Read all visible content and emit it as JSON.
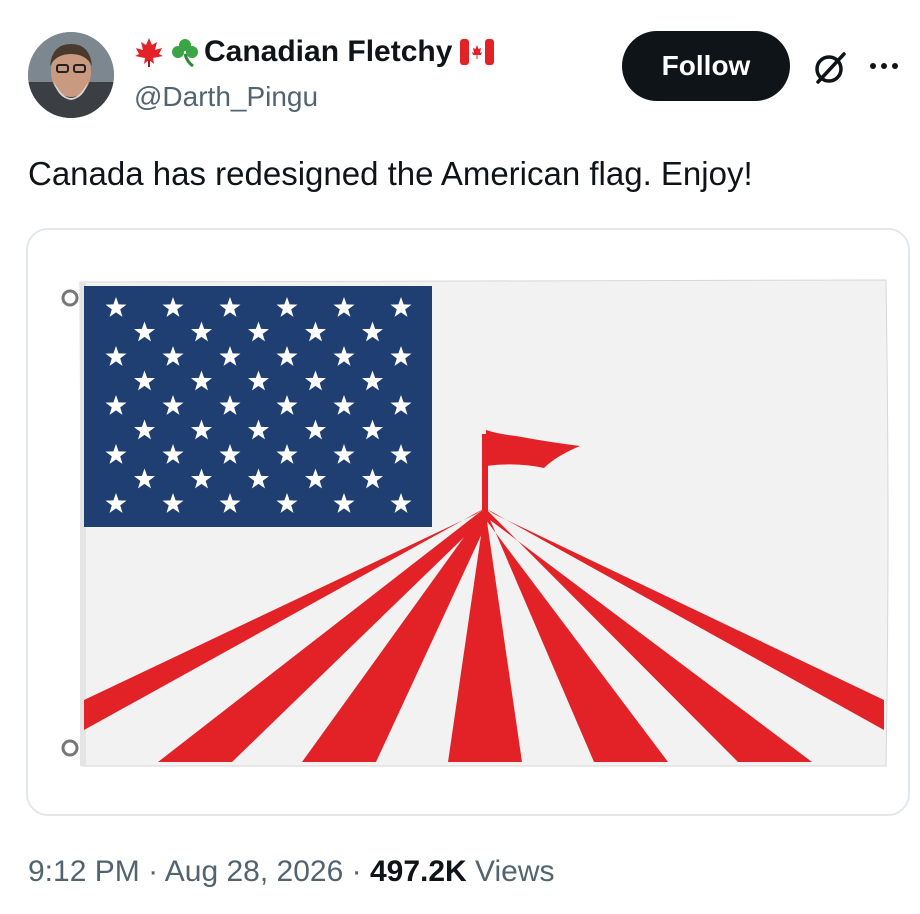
{
  "author": {
    "display_name": "Canadian Fletchy",
    "handle": "@Darth_Pingu",
    "name_emojis": [
      "maple-leaf",
      "shamrock",
      "canada-flag"
    ]
  },
  "actions": {
    "follow_label": "Follow"
  },
  "tweet": {
    "text": "Canada has redesigned the American flag. Enjoy!"
  },
  "meta": {
    "time": "9:12 PM",
    "separator": "·",
    "date": "Aug 28, 2026",
    "views_count": "497.2K",
    "views_label": "Views"
  },
  "colors": {
    "flag_blue": "#1f3f73",
    "flag_red": "#e32227",
    "flag_white": "#f2f2f2",
    "button_bg": "#0f1419",
    "secondary_text": "#536471"
  }
}
